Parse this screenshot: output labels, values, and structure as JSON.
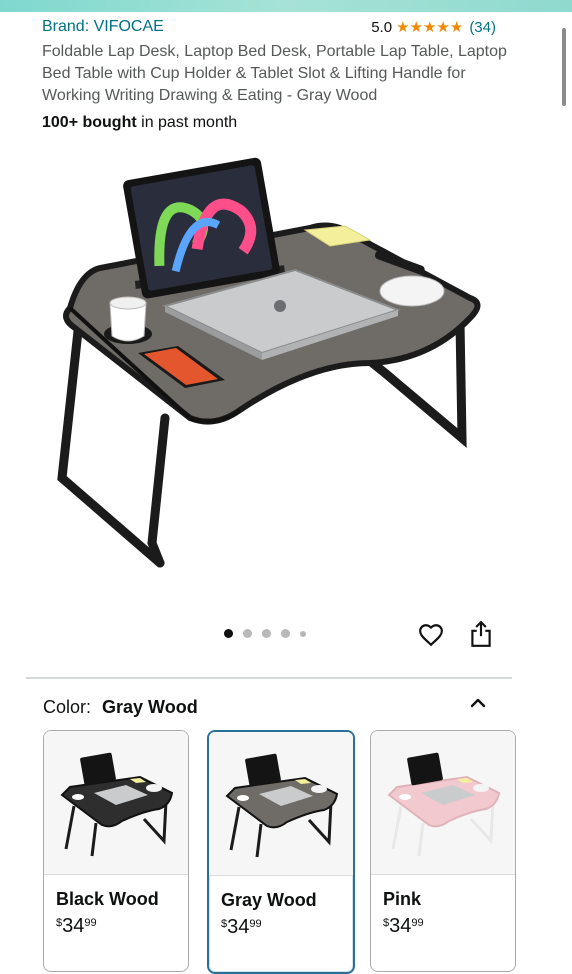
{
  "product": {
    "brand": "Brand: VIFOCAE",
    "rating_value": "5.0",
    "rating_stars": "★★★★★",
    "rating_count": "(34)",
    "title": "Foldable Lap Desk, Laptop Bed Desk, Portable Lap Table, Laptop Bed Table with Cup Holder & Tablet Slot & Lifting Handle for Working Writing Drawing & Eating - Gray Wood",
    "bought_bold": "100+ bought",
    "bought_rest": " in past month"
  },
  "gallery": {
    "image_count": 5,
    "active_index": 0
  },
  "color": {
    "label": "Color:",
    "selected": "Gray Wood",
    "options": [
      {
        "name": "Black Wood",
        "currency": "$",
        "dollars": "34",
        "cents": "99",
        "desk_color": "#2e2e2e"
      },
      {
        "name": "Gray Wood",
        "currency": "$",
        "dollars": "34",
        "cents": "99",
        "desk_color": "#6f6b66"
      },
      {
        "name": "Pink",
        "currency": "$",
        "dollars": "34",
        "cents": "99",
        "desk_color": "#f2c9cf"
      }
    ]
  },
  "colors": {
    "link": "#007185",
    "star": "#f08804",
    "selected_border": "#2a6f97"
  }
}
